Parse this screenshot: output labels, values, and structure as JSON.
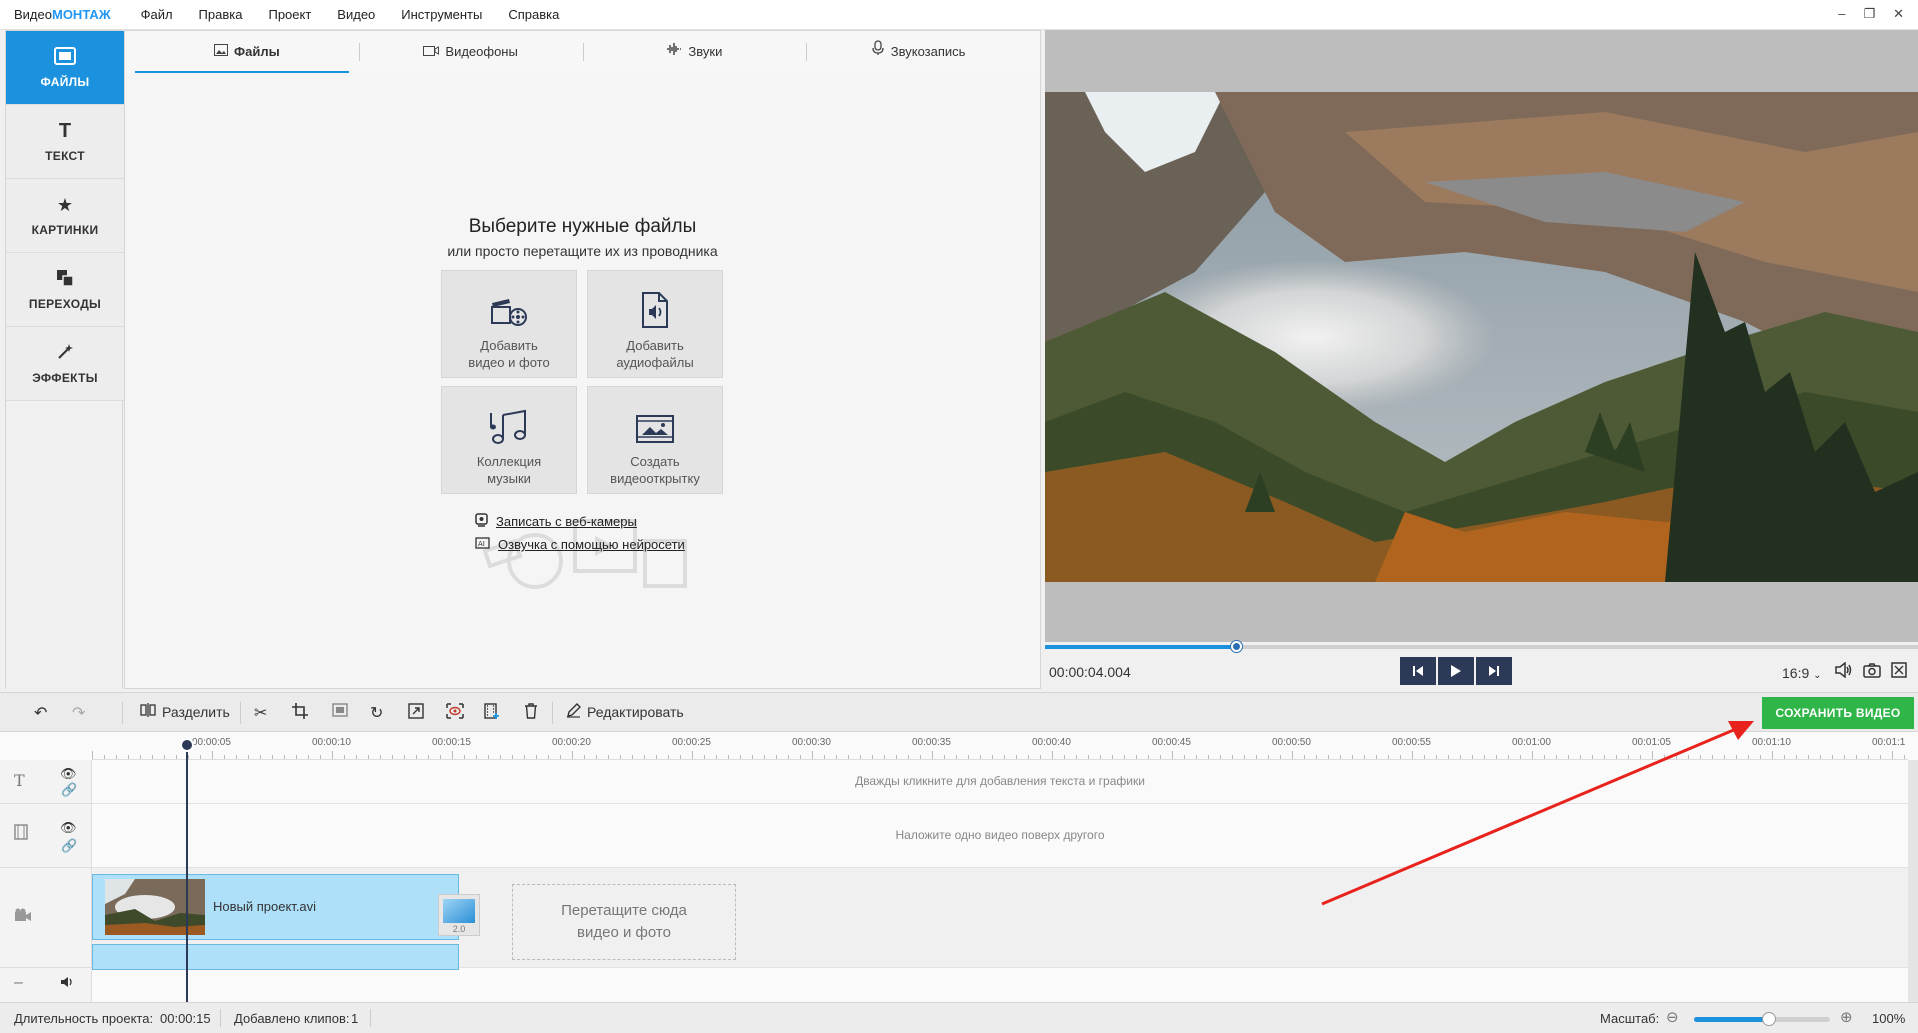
{
  "app": {
    "logo_prefix": "Видео",
    "logo_accent": "МОНТАЖ"
  },
  "menu": [
    "Файл",
    "Правка",
    "Проект",
    "Видео",
    "Инструменты",
    "Справка"
  ],
  "window_controls": [
    "–",
    "❐",
    "✕"
  ],
  "sidebar": [
    {
      "label": "ФАЙЛЫ",
      "icon": "files-icon",
      "active": true
    },
    {
      "label": "ТЕКСТ",
      "icon": "text-icon"
    },
    {
      "label": "КАРТИНКИ",
      "icon": "star-icon"
    },
    {
      "label": "ПЕРЕХОДЫ",
      "icon": "transitions-icon"
    },
    {
      "label": "ЭФФЕКТЫ",
      "icon": "magic-wand-icon"
    }
  ],
  "tabs": [
    {
      "label": "Файлы",
      "active": true
    },
    {
      "label": "Видеофоны"
    },
    {
      "label": "Звуки"
    },
    {
      "label": "Звукозапись"
    }
  ],
  "files_panel": {
    "title": "Выберите нужные файлы",
    "subtitle": "или просто перетащите их из проводника",
    "tiles": [
      {
        "line1": "Добавить",
        "line2": "видео и фото",
        "icon": "film-camera-icon"
      },
      {
        "line1": "Добавить",
        "line2": "аудиофайлы",
        "icon": "audio-file-icon"
      },
      {
        "line1": "Коллекция",
        "line2": "музыки",
        "icon": "music-notes-icon"
      },
      {
        "line1": "Создать",
        "line2": "видеооткрытку",
        "icon": "postcard-icon"
      }
    ],
    "links": [
      {
        "label": "Записать с веб-камеры",
        "icon": "webcam-icon"
      },
      {
        "label": "Озвучка с помощью нейросети",
        "icon": "ai-voice-icon"
      }
    ]
  },
  "preview": {
    "timecode": "00:00:04.004",
    "progress": 0.22,
    "aspect": "16:9"
  },
  "toolbar": {
    "split_label": "Разделить",
    "edit_label": "Редактировать",
    "save_label": "СОХРАНИТЬ ВИДЕО"
  },
  "timeline": {
    "ticks": [
      "00:00:05",
      "00:00:10",
      "00:00:15",
      "00:00:20",
      "00:00:25",
      "00:00:30",
      "00:00:35",
      "00:00:40",
      "00:00:45",
      "00:00:50",
      "00:00:55",
      "00:01:00",
      "00:01:05",
      "00:01:10",
      "00:01:1"
    ],
    "text_track_hint": "Дважды кликните для добавления текста и графики",
    "overlay_track_hint": "Наложите одно видео поверх другого",
    "clip_name": "Новый проект.avi",
    "transition_value": "2.0",
    "drop_zone_line1": "Перетащите сюда",
    "drop_zone_line2": "видео и фото"
  },
  "status": {
    "duration_label": "Длительность проекта:",
    "duration_value": "00:00:15",
    "clips_label": "Добавлено клипов:",
    "clips_value": "1",
    "zoom_label": "Масштаб:",
    "zoom_value": "100%",
    "zoom_level": 0.55
  },
  "colors": {
    "accent": "#1c92de",
    "save": "#2fb548",
    "annotation": "#e8221c"
  }
}
